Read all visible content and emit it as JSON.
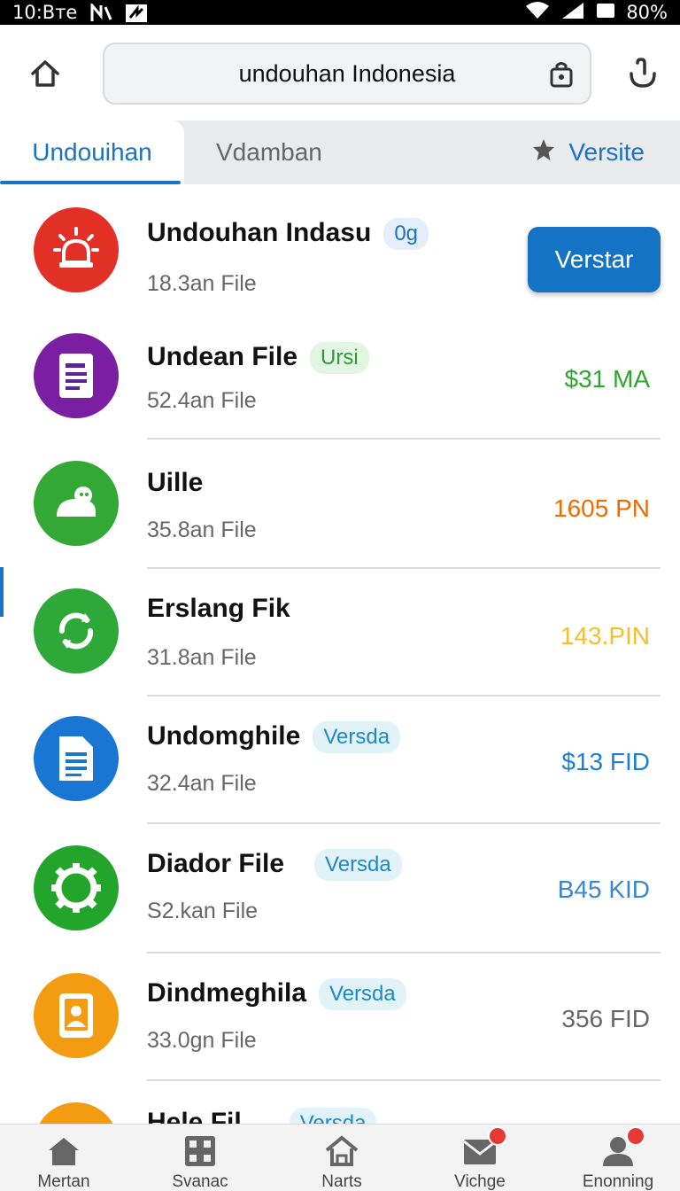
{
  "status_bar": {
    "time": "10:Bте",
    "battery": "80%"
  },
  "address_bar": {
    "url_text": "undouhan Indonesia"
  },
  "tabs": [
    {
      "label": "Undouihan"
    },
    {
      "label": "Vdamban"
    },
    {
      "label": "Versite"
    }
  ],
  "list": {
    "items": [
      {
        "title": "Undouhan Indasu",
        "badge": "0g",
        "subtitle": "18.3an File",
        "price": "",
        "action": "Verstar",
        "icon": "alarm-icon",
        "icon_color": "#e33027"
      },
      {
        "title": "Undean File",
        "badge": "Ursi",
        "subtitle": "52.4an File",
        "price": "$31 MA",
        "price_color": "#2fa52f",
        "icon": "document-icon",
        "icon_color": "#7b1fa2"
      },
      {
        "title": "Uille",
        "badge": "",
        "subtitle": "35.8an File",
        "price": "1605 PN",
        "price_color": "#ef6c00",
        "icon": "android-icon",
        "icon_color": "#34a834"
      },
      {
        "title": "Erslang Fik",
        "badge": "",
        "subtitle": "31.8an File",
        "price": "143.PIN",
        "price_color": "#f3c12b",
        "icon": "sync-icon",
        "icon_color": "#2fa83a"
      },
      {
        "title": "Undomghile",
        "badge": "Versda",
        "subtitle": "32.4an File",
        "price": "$13 FID",
        "price_color": "#1e7fd0",
        "icon": "file-icon",
        "icon_color": "#1976d2"
      },
      {
        "title": "Diador File",
        "badge": "Versda",
        "subtitle": "S2.kan File",
        "price": "B45 KID",
        "price_color": "#3a86cf",
        "icon": "gear-icon",
        "icon_color": "#22a52a"
      },
      {
        "title": "Dindmeghila",
        "badge": "Versda",
        "subtitle": "33.0gn File",
        "price": "356 FID",
        "price_color": "#666666",
        "icon": "contact-icon",
        "icon_color": "#f39c12"
      },
      {
        "title": "Hele Fil",
        "badge": "Versda",
        "subtitle": "",
        "price": "",
        "icon": "partial-icon",
        "icon_color": "#f39c12"
      }
    ]
  },
  "bottom_nav": [
    {
      "label": "Mertan",
      "icon": "home-icon"
    },
    {
      "label": "Svanac",
      "icon": "grid-icon"
    },
    {
      "label": "Narts",
      "icon": "house-outline-icon"
    },
    {
      "label": "Vichge",
      "icon": "mail-icon",
      "badge": true
    },
    {
      "label": "Enonning",
      "icon": "person-icon",
      "badge": true
    }
  ]
}
